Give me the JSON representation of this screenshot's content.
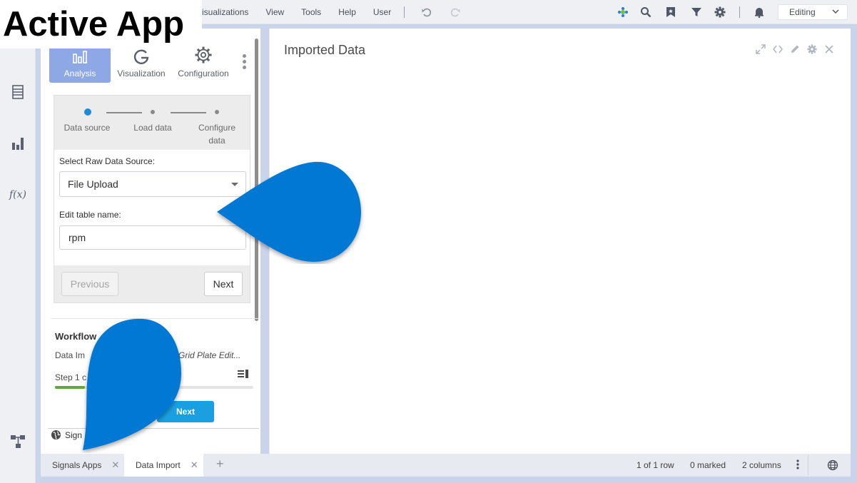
{
  "overlay": {
    "title": "Active App"
  },
  "menu": {
    "items": [
      "isualizations",
      "View",
      "Tools",
      "Help",
      "User"
    ]
  },
  "toolbar": {
    "icons": [
      "undo-icon",
      "redo-icon",
      "spotfire-logo-icon",
      "search-icon",
      "bookmark-icon",
      "filter-icon",
      "gear-icon",
      "bell-icon"
    ],
    "mode_label": "Editing"
  },
  "rail": {
    "icons": [
      "data-table-icon",
      "bar-chart-icon",
      "fx-icon",
      "flow-icon"
    ],
    "fx_label": "f(x)"
  },
  "panel": {
    "tabs": [
      {
        "label": "Analysis",
        "icon": "bar-chart-icon"
      },
      {
        "label": "Visualization",
        "icon": "chart-g-icon"
      },
      {
        "label": "Configuration",
        "icon": "gear-icon"
      }
    ],
    "steps": [
      {
        "label": "Data source",
        "state": "active"
      },
      {
        "label": "Load data",
        "state": "pending"
      },
      {
        "label": "Configure data",
        "state": "pending"
      }
    ],
    "steps_labels": {
      "s1": "Data source",
      "s2": "Load data",
      "s3a": "Configure",
      "s3b": "data"
    },
    "form": {
      "source_label": "Select Raw Data Source:",
      "source_value": "File Upload",
      "table_label": "Edit table name:",
      "table_value": "rpm"
    },
    "buttons": {
      "previous": "Previous",
      "next": "Next"
    },
    "workflow": {
      "title": "Workflow",
      "desc_left": "Data Im",
      "desc_right": "Grid Plate Edit...",
      "step": "Step 1 c",
      "progress": 0.15,
      "next": "Next",
      "signals": "Sign"
    }
  },
  "main": {
    "title": "Imported Data",
    "icons": [
      "maximize-icon",
      "code-icon",
      "pencil-icon",
      "gear-icon",
      "close-icon"
    ]
  },
  "statusbar": {
    "tabs": [
      {
        "label": "Signals Apps",
        "active": false
      },
      {
        "label": "Data Import",
        "active": true
      }
    ],
    "add": "+",
    "rows": "1 of 1 row",
    "marked": "0 marked",
    "columns": "2 columns"
  },
  "colors": {
    "accent_blue": "#0078d4",
    "tab_active": "#8ea8e6",
    "next_button": "#1aa0e0",
    "progress_green": "#5fa839",
    "backdrop": "#c9d3ea"
  }
}
